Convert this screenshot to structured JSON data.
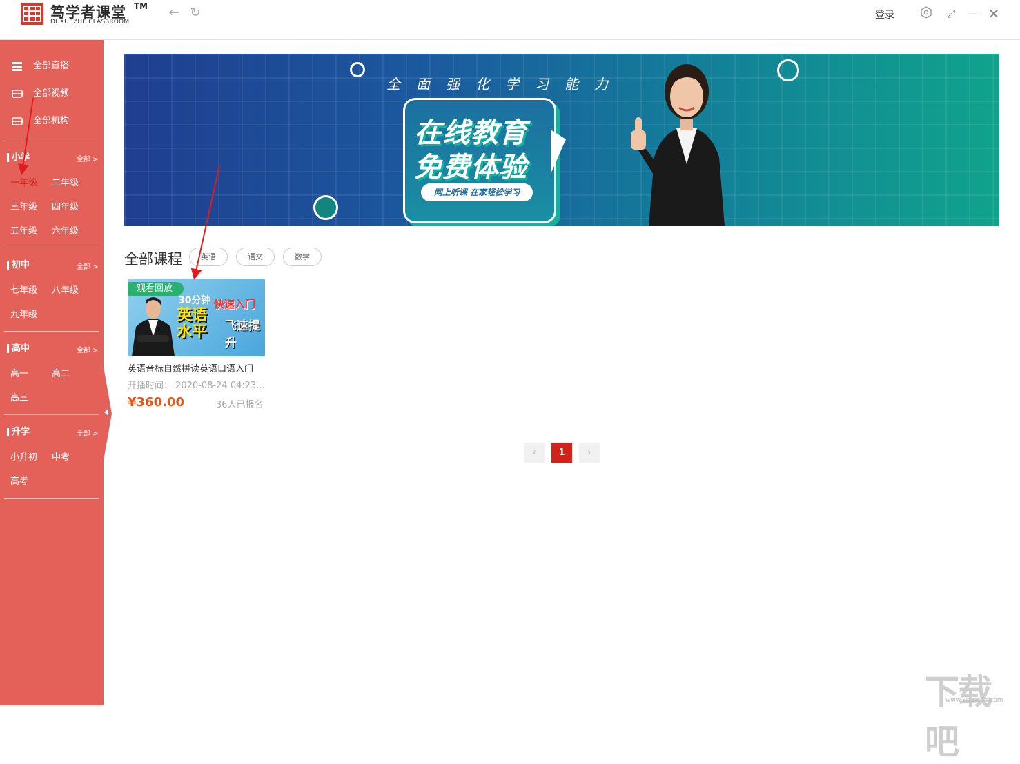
{
  "app": {
    "name": "笃学者课堂",
    "tm": "TM",
    "subtitle": "DUXUEZHE CLASSROOM",
    "login": "登录"
  },
  "sidebar": {
    "top": [
      {
        "label": "全部直播",
        "icon": "live-icon"
      },
      {
        "label": "全部视频",
        "icon": "video-icon"
      },
      {
        "label": "全部机构",
        "icon": "institution-icon"
      }
    ],
    "sections": [
      {
        "title": "小学",
        "all": "全部 >",
        "grades": [
          "一年级",
          "二年级",
          "三年级",
          "四年级",
          "五年级",
          "六年级"
        ]
      },
      {
        "title": "初中",
        "all": "全部 >",
        "grades": [
          "七年级",
          "八年级",
          "九年级"
        ]
      },
      {
        "title": "高中",
        "all": "全部 >",
        "grades": [
          "高一",
          "高二",
          "高三"
        ]
      },
      {
        "title": "升学",
        "all": "全部 >",
        "grades": [
          "小升初",
          "中考",
          "高考"
        ]
      }
    ],
    "active_grade": "一年级"
  },
  "banner": {
    "slogan": "全面强化学习能力",
    "line1": "在线教育",
    "line2": "免费体验",
    "pill": "网上听课 在家轻松学习"
  },
  "courses": {
    "heading": "全部课程",
    "tags": [
      "英语",
      "语文",
      "数学"
    ],
    "items": [
      {
        "badge": "观看回放",
        "thumb_line1": "30分钟",
        "thumb_red": "快速入门",
        "thumb_line2": "英语",
        "thumb_line3": "水平",
        "thumb_up": "飞速提升",
        "title": "英语音标自然拼读英语口语入门",
        "time_label": "开播时间：",
        "time": "2020-08-24 04:23...",
        "price": "¥360.00",
        "enrolled": "36人已报名"
      }
    ]
  },
  "pagination": {
    "prev": "‹",
    "current": "1",
    "next": "›"
  },
  "watermark": {
    "text": "下载吧",
    "url": "www.xiazaiba.com"
  },
  "colors": {
    "sidebar": "#e4615a",
    "accent": "#d1231a",
    "price": "#e05a1f",
    "badge": "#2bb16f"
  }
}
